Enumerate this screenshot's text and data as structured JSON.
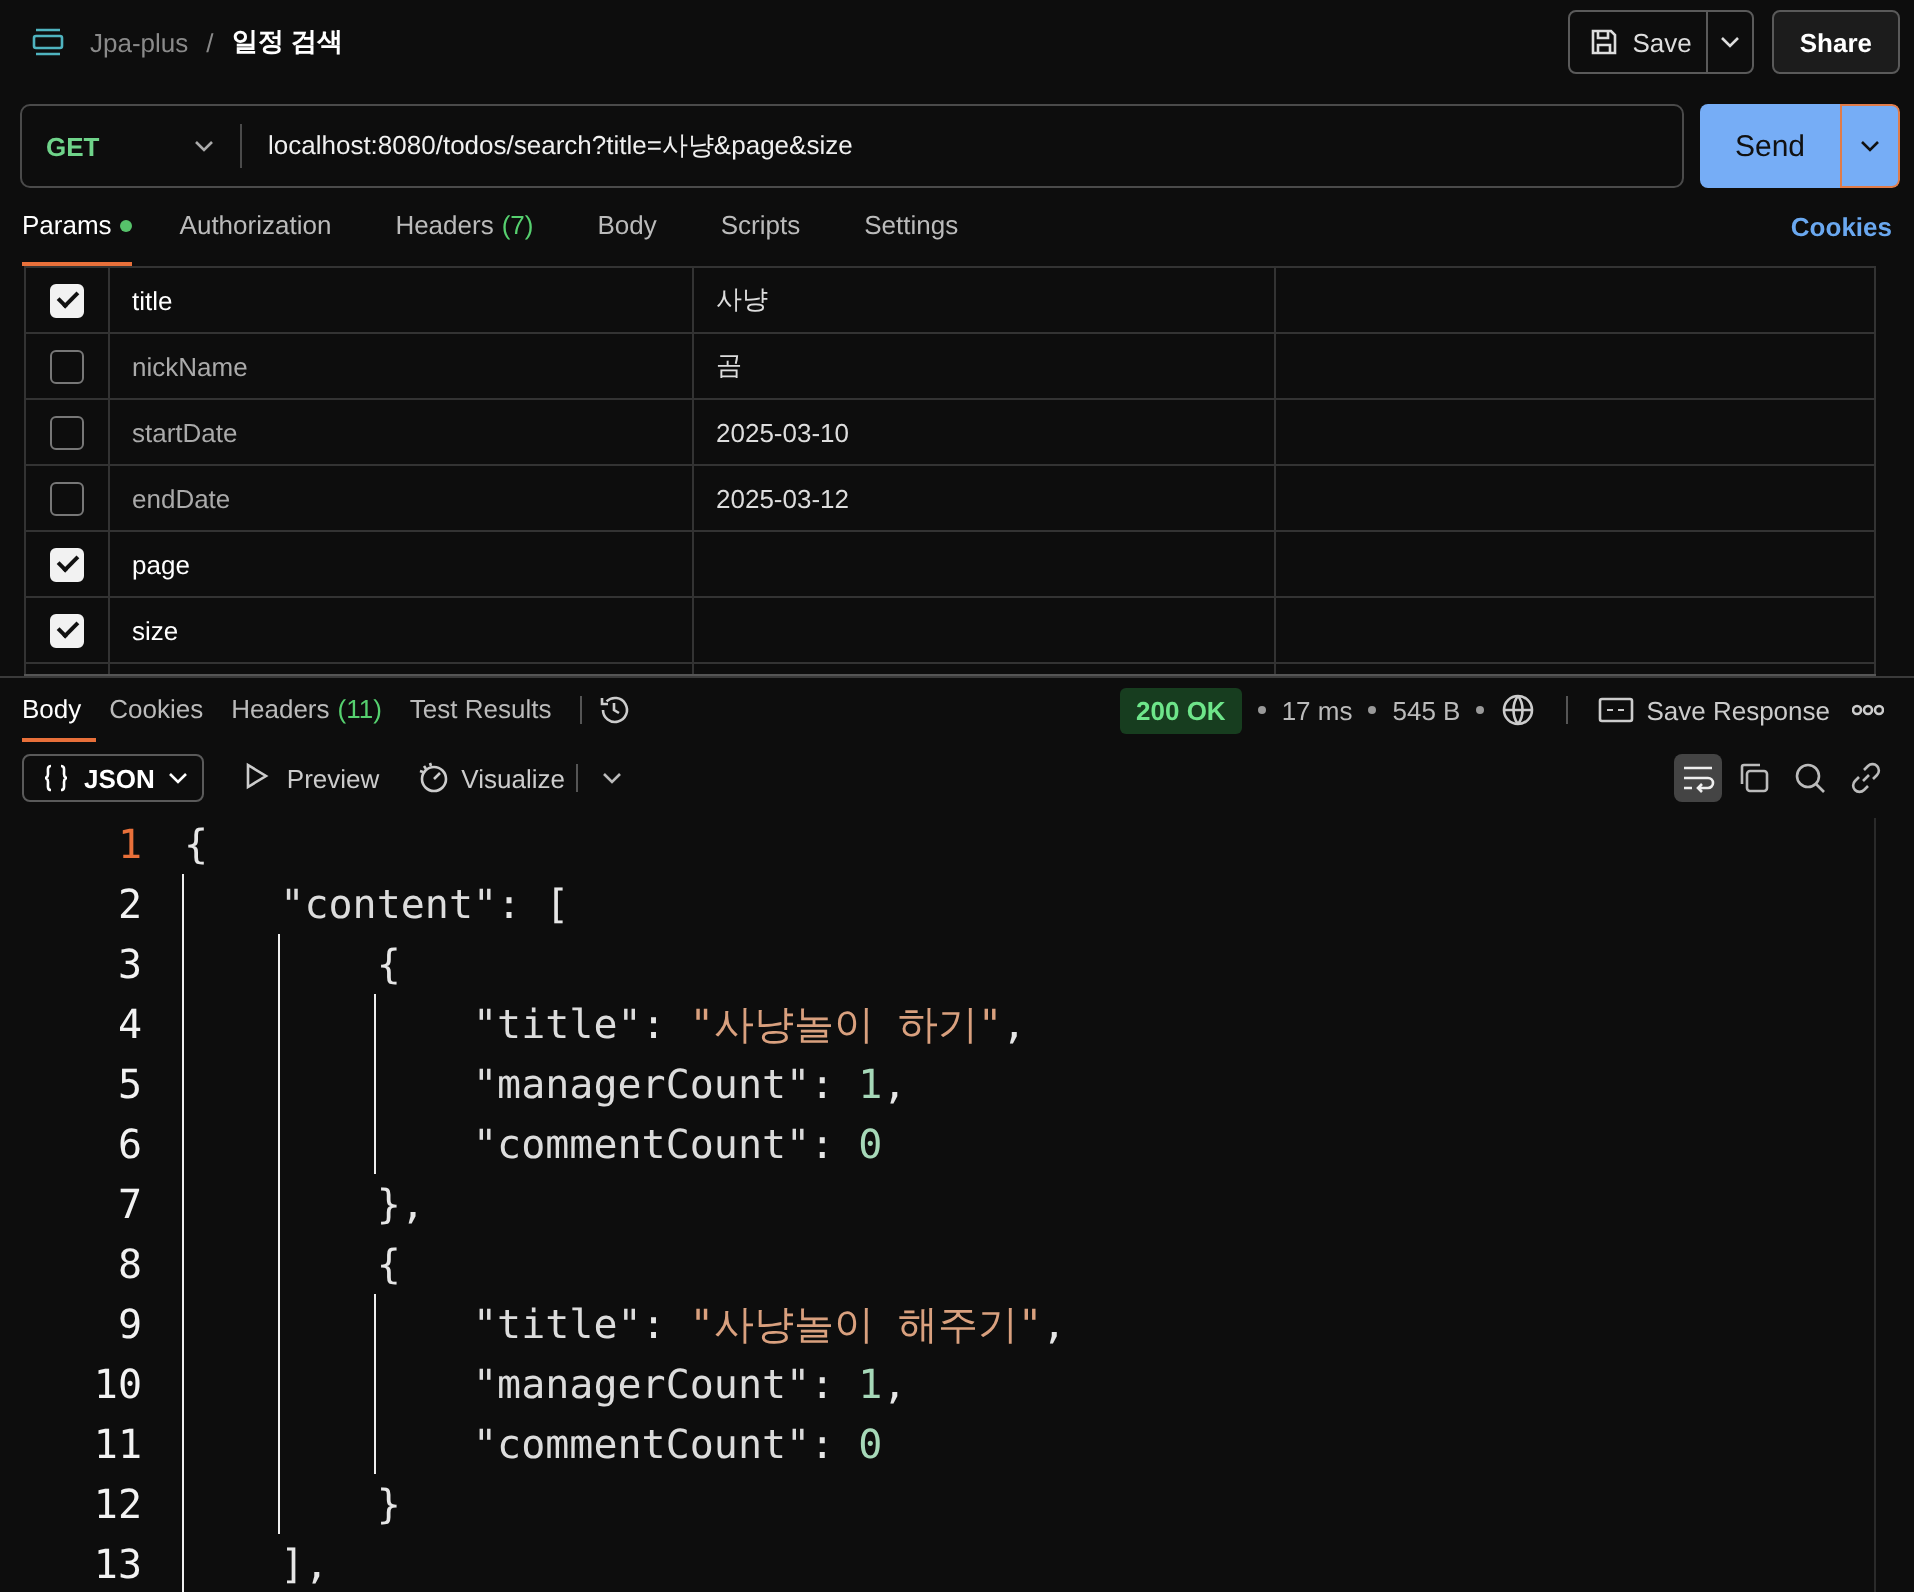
{
  "header": {
    "collection": "Jpa-plus",
    "separator": "/",
    "request_name": "일정 검색",
    "save_label": "Save",
    "share_label": "Share"
  },
  "request": {
    "method": "GET",
    "url": "localhost:8080/todos/search?title=사냥&page&size",
    "send_label": "Send"
  },
  "request_tabs": [
    {
      "label": "Params",
      "selected": true,
      "dot": true
    },
    {
      "label": "Authorization",
      "selected": false,
      "dot": false
    },
    {
      "label": "Headers",
      "count": "(7)",
      "selected": false,
      "dot": false
    },
    {
      "label": "Body",
      "selected": false,
      "dot": false
    },
    {
      "label": "Scripts",
      "selected": false,
      "dot": false
    },
    {
      "label": "Settings",
      "selected": false,
      "dot": false
    }
  ],
  "cookies_link": "Cookies",
  "params": [
    {
      "checked": true,
      "key": "title",
      "value": "사냥"
    },
    {
      "checked": false,
      "key": "nickName",
      "value": "곰"
    },
    {
      "checked": false,
      "key": "startDate",
      "value": "2025-03-10"
    },
    {
      "checked": false,
      "key": "endDate",
      "value": "2025-03-12"
    },
    {
      "checked": true,
      "key": "page"
    },
    {
      "checked": true,
      "key": "size"
    }
  ],
  "response": {
    "tabs": [
      {
        "label": "Body",
        "selected": true
      },
      {
        "label": "Cookies",
        "selected": false
      },
      {
        "label": "Headers",
        "count": "(11)",
        "selected": false
      },
      {
        "label": "Test Results",
        "selected": false
      }
    ],
    "status": "200 OK",
    "time": "17 ms",
    "size": "545 B",
    "save_response": "Save Response",
    "format": "JSON",
    "views": [
      "Preview",
      "Visualize"
    ],
    "word_wrap": true
  },
  "code_lines": [
    {
      "number": "1",
      "current": true,
      "tokens": [
        {
          "kind": "punct",
          "text": "{"
        }
      ]
    },
    {
      "number": "2",
      "current": false,
      "tokens": [
        {
          "kind": "key",
          "text": "    \"content\""
        },
        {
          "kind": "punct",
          "text": ": ["
        }
      ]
    },
    {
      "number": "3",
      "current": false,
      "tokens": [
        {
          "kind": "punct",
          "text": "        {"
        }
      ]
    },
    {
      "number": "4",
      "current": false,
      "tokens": [
        {
          "kind": "key",
          "text": "            \"title\""
        },
        {
          "kind": "punct",
          "text": ": "
        },
        {
          "kind": "string",
          "text": "\"사냥놀이 하기\""
        },
        {
          "kind": "punct",
          "text": ","
        }
      ]
    },
    {
      "number": "5",
      "current": false,
      "tokens": [
        {
          "kind": "key",
          "text": "            \"managerCount\""
        },
        {
          "kind": "punct",
          "text": ": "
        },
        {
          "kind": "number",
          "text": "1"
        },
        {
          "kind": "punct",
          "text": ","
        }
      ]
    },
    {
      "number": "6",
      "current": false,
      "tokens": [
        {
          "kind": "key",
          "text": "            \"commentCount\""
        },
        {
          "kind": "punct",
          "text": ": "
        },
        {
          "kind": "number",
          "text": "0"
        }
      ]
    },
    {
      "number": "7",
      "current": false,
      "tokens": [
        {
          "kind": "punct",
          "text": "        },"
        }
      ]
    },
    {
      "number": "8",
      "current": false,
      "tokens": [
        {
          "kind": "punct",
          "text": "        {"
        }
      ]
    },
    {
      "number": "9",
      "current": false,
      "tokens": [
        {
          "kind": "key",
          "text": "            \"title\""
        },
        {
          "kind": "punct",
          "text": ": "
        },
        {
          "kind": "string",
          "text": "\"사냥놀이 해주기\""
        },
        {
          "kind": "punct",
          "text": ","
        }
      ]
    },
    {
      "number": "10",
      "current": false,
      "tokens": [
        {
          "kind": "key",
          "text": "            \"managerCount\""
        },
        {
          "kind": "punct",
          "text": ": "
        },
        {
          "kind": "number",
          "text": "1"
        },
        {
          "kind": "punct",
          "text": ","
        }
      ]
    },
    {
      "number": "11",
      "current": false,
      "tokens": [
        {
          "kind": "key",
          "text": "            \"commentCount\""
        },
        {
          "kind": "punct",
          "text": ": "
        },
        {
          "kind": "number",
          "text": "0"
        }
      ]
    },
    {
      "number": "12",
      "current": false,
      "tokens": [
        {
          "kind": "punct",
          "text": "        }"
        }
      ]
    },
    {
      "number": "13",
      "current": false,
      "tokens": [
        {
          "kind": "punct",
          "text": "    ],"
        }
      ]
    }
  ]
}
